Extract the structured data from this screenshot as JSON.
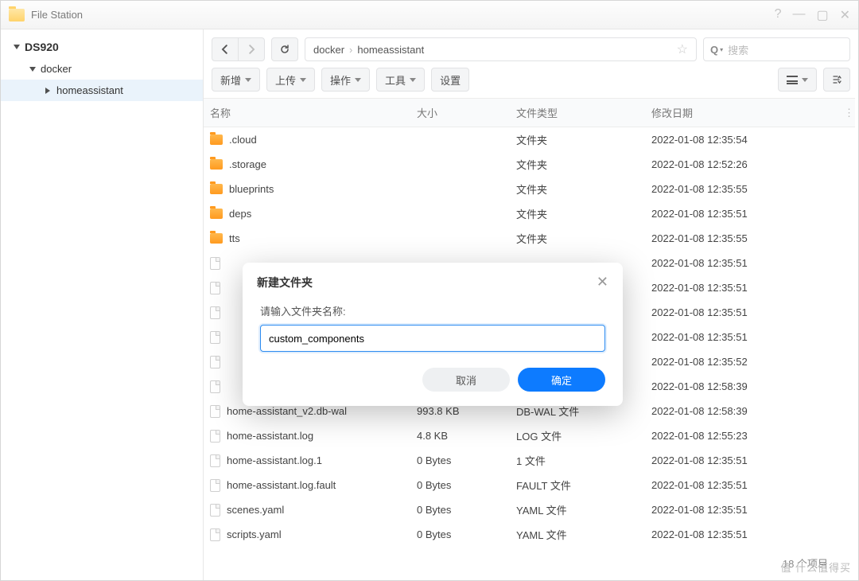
{
  "app": {
    "title": "File Station"
  },
  "window_controls": {
    "help": "?",
    "min": "—",
    "max": "▢",
    "close": "✕"
  },
  "sidebar": {
    "root": "DS920",
    "items": [
      {
        "label": "docker"
      },
      {
        "label": "homeassistant"
      }
    ]
  },
  "toolbar": {
    "new": "新增",
    "upload": "上传",
    "action": "操作",
    "tools": "工具",
    "settings": "设置"
  },
  "breadcrumb": {
    "parts": [
      "docker",
      "homeassistant"
    ],
    "sep": "›"
  },
  "search": {
    "placeholder": "搜索"
  },
  "columns": {
    "name": "名称",
    "size": "大小",
    "type": "文件类型",
    "modified": "修改日期"
  },
  "rows": [
    {
      "icon": "folder",
      "name": ".cloud",
      "size": "",
      "type": "文件夹",
      "modified": "2022-01-08 12:35:54"
    },
    {
      "icon": "folder",
      "name": ".storage",
      "size": "",
      "type": "文件夹",
      "modified": "2022-01-08 12:52:26"
    },
    {
      "icon": "folder",
      "name": "blueprints",
      "size": "",
      "type": "文件夹",
      "modified": "2022-01-08 12:35:55"
    },
    {
      "icon": "folder",
      "name": "deps",
      "size": "",
      "type": "文件夹",
      "modified": "2022-01-08 12:35:51"
    },
    {
      "icon": "folder",
      "name": "tts",
      "size": "",
      "type": "文件夹",
      "modified": "2022-01-08 12:35:55"
    },
    {
      "icon": "file",
      "name": "",
      "size": "",
      "type": "",
      "modified": "2022-01-08 12:35:51"
    },
    {
      "icon": "file",
      "name": "",
      "size": "",
      "type": "",
      "modified": "2022-01-08 12:35:51"
    },
    {
      "icon": "file",
      "name": "",
      "size": "",
      "type": "",
      "modified": "2022-01-08 12:35:51"
    },
    {
      "icon": "file",
      "name": "",
      "size": "",
      "type": "",
      "modified": "2022-01-08 12:35:51"
    },
    {
      "icon": "file",
      "name": "",
      "size": "",
      "type": "",
      "modified": "2022-01-08 12:35:52"
    },
    {
      "icon": "file",
      "name": "",
      "size": "",
      "type": "",
      "modified": "2022-01-08 12:58:39"
    },
    {
      "icon": "file",
      "name": "home-assistant_v2.db-wal",
      "size": "993.8 KB",
      "type": "DB-WAL 文件",
      "modified": "2022-01-08 12:58:39"
    },
    {
      "icon": "file",
      "name": "home-assistant.log",
      "size": "4.8 KB",
      "type": "LOG 文件",
      "modified": "2022-01-08 12:55:23"
    },
    {
      "icon": "file",
      "name": "home-assistant.log.1",
      "size": "0 Bytes",
      "type": "1 文件",
      "modified": "2022-01-08 12:35:51"
    },
    {
      "icon": "file",
      "name": "home-assistant.log.fault",
      "size": "0 Bytes",
      "type": "FAULT 文件",
      "modified": "2022-01-08 12:35:51"
    },
    {
      "icon": "file",
      "name": "scenes.yaml",
      "size": "0 Bytes",
      "type": "YAML 文件",
      "modified": "2022-01-08 12:35:51"
    },
    {
      "icon": "file",
      "name": "scripts.yaml",
      "size": "0 Bytes",
      "type": "YAML 文件",
      "modified": "2022-01-08 12:35:51"
    }
  ],
  "footer": {
    "count": "18 个项目"
  },
  "modal": {
    "title": "新建文件夹",
    "label": "请输入文件夹名称:",
    "value": "custom_components",
    "cancel": "取消",
    "ok": "确定"
  },
  "watermark": "值 什么值得买"
}
